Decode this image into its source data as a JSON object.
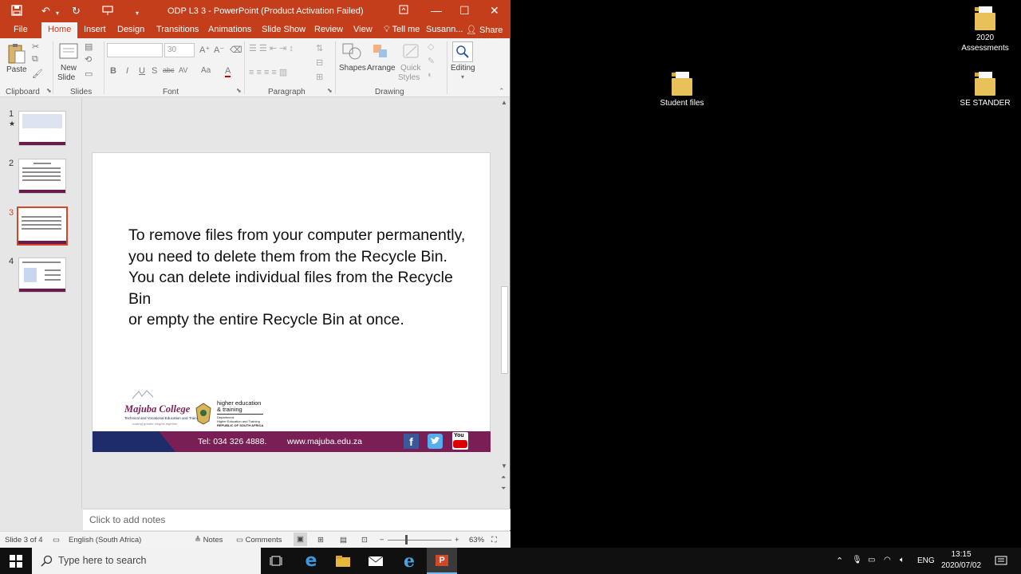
{
  "window": {
    "title": "ODP L3 3 - PowerPoint (Product Activation Failed)",
    "user": "Susann...",
    "share": "Share",
    "tell_me": "Tell me"
  },
  "tabs": [
    "File",
    "Home",
    "Insert",
    "Design",
    "Transitions",
    "Animations",
    "Slide Show",
    "Review",
    "View"
  ],
  "ribbon": {
    "paste": "Paste",
    "new_slide_1": "New",
    "new_slide_2": "Slide",
    "font_size": "30",
    "shapes": "Shapes",
    "arrange": "Arrange",
    "quick_1": "Quick",
    "quick_2": "Styles",
    "editing": "Editing",
    "groups": {
      "clipboard": "Clipboard",
      "slides": "Slides",
      "font": "Font",
      "paragraph": "Paragraph",
      "drawing": "Drawing"
    },
    "font_buttons": [
      "B",
      "I",
      "U",
      "S",
      "abc",
      "AV",
      "Aa",
      "A"
    ]
  },
  "thumbnails": [
    {
      "num": "1",
      "star": "★"
    },
    {
      "num": "2"
    },
    {
      "num": "3"
    },
    {
      "num": "4"
    }
  ],
  "slide": {
    "lines": [
      "To remove files from your computer permanently,",
      "you need to delete them from the Recycle Bin.",
      "You can delete individual files from the Recycle Bin",
      "or empty the entire Recycle Bin at once."
    ],
    "college_name": "Majuba College",
    "college_sub": "Technical and Vocational Education and Training",
    "college_tag": "making greater heights together",
    "dept_1": "higher education",
    "dept_2": "& training",
    "dept_3": "Department:",
    "dept_4": "Higher Education and Training",
    "dept_5": "REPUBLIC OF SOUTH AFRICA",
    "tel": "Tel: 034 326 4888.",
    "web": "www.majuba.edu.za",
    "yt": "You"
  },
  "notes": {
    "placeholder": "Click to add notes"
  },
  "status": {
    "slide": "Slide 3 of 4",
    "lang": "English (South Africa)",
    "notes": "Notes",
    "comments": "Comments",
    "zoom": "63%"
  },
  "desktop": [
    {
      "label_1": "2020",
      "label_2": "Assessments"
    },
    {
      "label_1": "Student files"
    },
    {
      "label_1": "SE STANDER"
    }
  ],
  "taskbar": {
    "search": "Type here to search",
    "lang": "ENG",
    "time": "13:15",
    "date": "2020/07/02"
  }
}
